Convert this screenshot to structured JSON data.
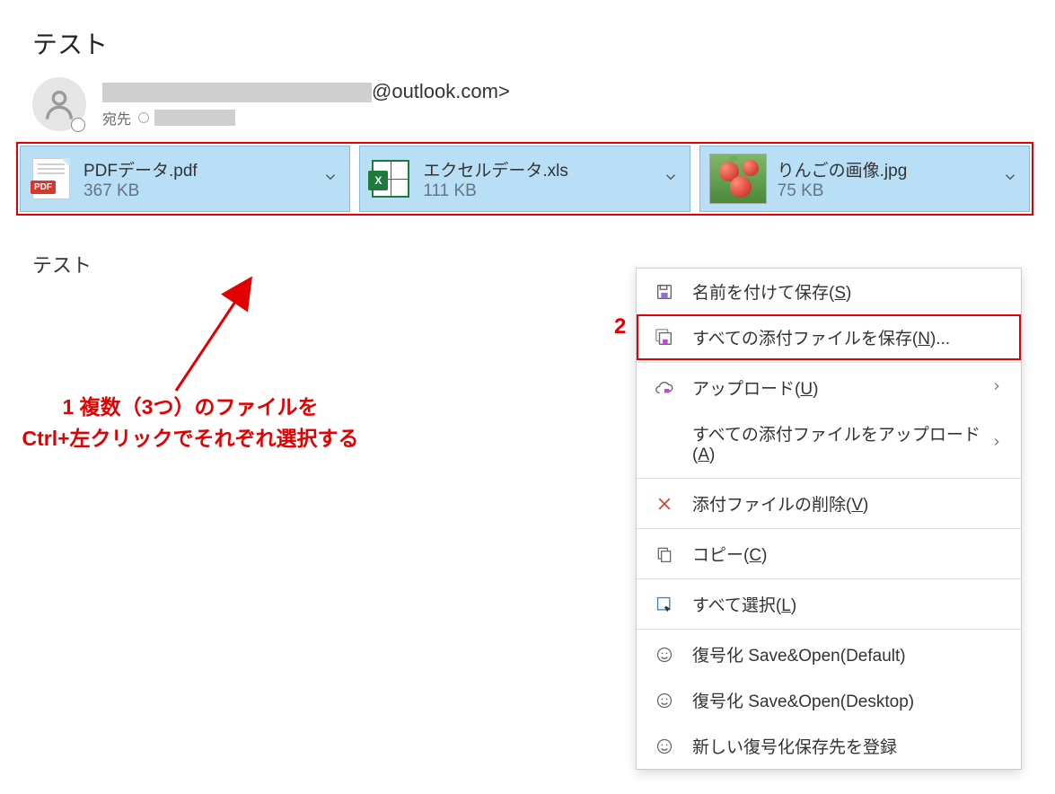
{
  "email": {
    "subject": "テスト",
    "sender_suffix": "@outlook.com>",
    "to_label": "宛先",
    "body": "テスト"
  },
  "attachments": [
    {
      "name": "PDFデータ.pdf",
      "size": "367 KB",
      "icon": "pdf",
      "pdf_badge": "PDF"
    },
    {
      "name": "エクセルデータ.xls",
      "size": "111 KB",
      "icon": "xls",
      "xls_badge": "X"
    },
    {
      "name": "りんごの画像.jpg",
      "size": "75 KB",
      "icon": "apples"
    }
  ],
  "annotations": {
    "step1_line1": "1 複数（3つ）のファイルを",
    "step1_line2": "Ctrl+左クリックでそれぞれ選択する",
    "step2": "2"
  },
  "menu": {
    "save_as_pre": "名前を付けて保存(",
    "save_as_key": "S",
    "save_as_post": ")",
    "save_all_pre": "すべての添付ファイルを保存(",
    "save_all_key": "N",
    "save_all_post": ")...",
    "upload_pre": "アップロード(",
    "upload_key": "U",
    "upload_post": ")",
    "upload_all_pre": "すべての添付ファイルをアップロード(",
    "upload_all_key": "A",
    "upload_all_post": ")",
    "delete_pre": "添付ファイルの削除(",
    "delete_key": "V",
    "delete_post": ")",
    "copy_pre": "コピー(",
    "copy_key": "C",
    "copy_post": ")",
    "select_all_pre": "すべて選択(",
    "select_all_key": "L",
    "select_all_post": ")",
    "decrypt_default": "復号化 Save&Open(Default)",
    "decrypt_desktop": "復号化 Save&Open(Desktop)",
    "decrypt_register": "新しい復号化保存先を登録"
  }
}
